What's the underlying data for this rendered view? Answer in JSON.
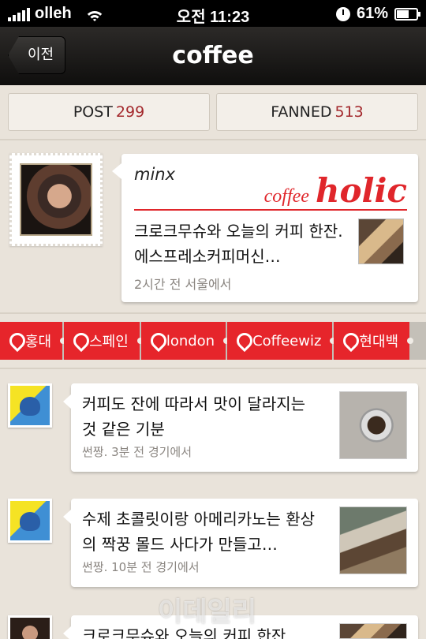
{
  "status_bar": {
    "carrier": "olleh",
    "time": "오전 11:23",
    "battery": "61%",
    "battery_level": 0.61
  },
  "nav": {
    "back_label": "이전",
    "title": "coffee"
  },
  "stats": {
    "post_label": "POST",
    "post_count": "299",
    "fanned_label": "FANNED",
    "fanned_count": "513"
  },
  "featured": {
    "user": "minx",
    "badge_word1": "coffee",
    "badge_word2": "holic",
    "text": "크로크무슈와 오늘의 커피 한잔. 에스프레소커피머신…",
    "meta": "2시간 전 서울에서"
  },
  "tags": [
    "홍대",
    "스페인",
    "london",
    "Coffeewiz",
    "현대백"
  ],
  "feed": [
    {
      "text": "커피도 잔에 따라서 맛이 달라지는 것 같은 기분",
      "meta": "썬짱. 3분 전 경기에서"
    },
    {
      "text": "수제 초콜릿이랑 아메리카노는 환상의 짝꿍 몰드 사다가 만들고…",
      "meta": "썬짱. 10분 전 경기에서"
    },
    {
      "text": "크로크무슈와 오늘의 커피 한잔",
      "meta": ""
    }
  ],
  "watermark": "이데일리",
  "colors": {
    "accent_red": "#e6252b",
    "count_red": "#a3282c",
    "background": "#e9e3da"
  }
}
